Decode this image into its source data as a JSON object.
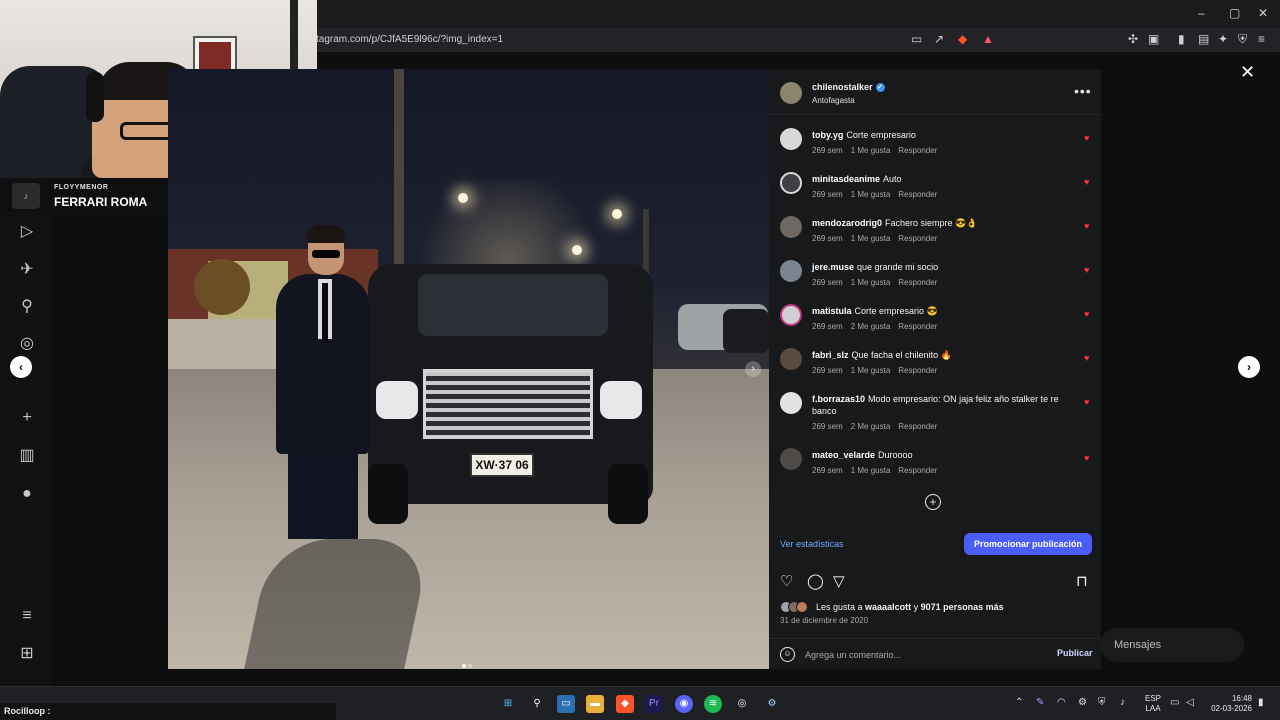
{
  "browser": {
    "url": "tagram.com/p/CJfA5E9l96c/?img_index=1",
    "window_controls": [
      "–",
      "▢",
      "✕"
    ]
  },
  "streamer": {
    "name": "FLOYYMENOR",
    "song": "FERRARI ROMA"
  },
  "post": {
    "author": "chilenostalker",
    "location": "Antofagasta",
    "plate": "XW·37 06",
    "comments": [
      {
        "user": "toby.yg",
        "text": "Corte empresario",
        "time": "269 sem",
        "likes": "1 Me gusta",
        "reply": "Responder"
      },
      {
        "user": "minitasdeanime",
        "text": "Auto",
        "time": "269 sem",
        "likes": "1 Me gusta",
        "reply": "Responder"
      },
      {
        "user": "mendozarodrig0",
        "text": "Fachero siempre 😎👌",
        "time": "269 sem",
        "likes": "1 Me gusta",
        "reply": "Responder"
      },
      {
        "user": "jere.muse",
        "text": "que grande mi socio",
        "time": "269 sem",
        "likes": "1 Me gusta",
        "reply": "Responder"
      },
      {
        "user": "matistula",
        "text": "Corte empresario 😎",
        "time": "269 sem",
        "likes": "2 Me gusta",
        "reply": "Responder"
      },
      {
        "user": "fabri_slz",
        "text": "Que facha el chilenito 🔥",
        "time": "269 sem",
        "likes": "1 Me gusta",
        "reply": "Responder"
      },
      {
        "user": "f.borrazas10",
        "text": "Modo empresario: ON jaja feliz año stalker te re banco",
        "time": "269 sem",
        "likes": "2 Me gusta",
        "reply": "Responder"
      },
      {
        "user": "mateo_velarde",
        "text": "Duroooo",
        "time": "269 sem",
        "likes": "1 Me gusta",
        "reply": "Responder"
      }
    ],
    "stats_link": "Ver estadísticas",
    "promote_button": "Promocionar publicación",
    "likes_prefix": "Les gusta a ",
    "likes_user": "waaaalcott",
    "likes_middle": " y ",
    "likes_count": "9071 personas más",
    "date": "31 de diciembre de 2020",
    "comment_placeholder": "Agrega un comentario...",
    "publish_label": "Publicar"
  },
  "messages_label": "Mensajes",
  "taskbar": {
    "lang_top": "ESP",
    "lang_bottom": "LAA",
    "time": "16:48",
    "date": "02-03-2026"
  },
  "chat": {
    "line": "Rocilloop :"
  },
  "colors": {
    "accent": "#4a5df9",
    "link": "#6ea8fe",
    "heart": "#ff3040",
    "panel": "#18191b"
  }
}
